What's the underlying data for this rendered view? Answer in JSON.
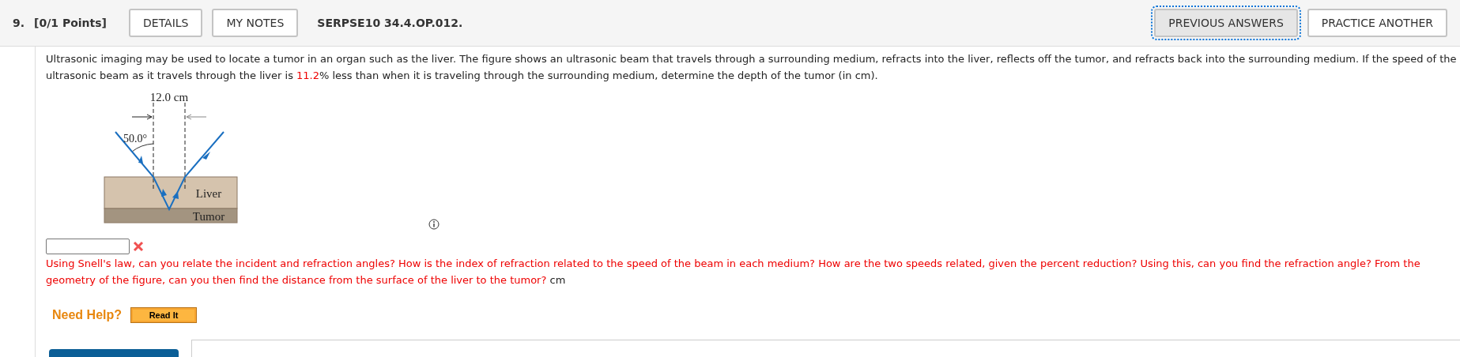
{
  "header": {
    "number": "9.",
    "points": "[0/1 Points]",
    "buttons": [
      {
        "label": "DETAILS",
        "selected": false
      },
      {
        "label": "MY NOTES",
        "selected": false
      }
    ],
    "code": "SERPSE10 34.4.OP.012.",
    "actions": [
      {
        "label": "PREVIOUS ANSWERS",
        "selected": true
      },
      {
        "label": "PRACTICE ANOTHER",
        "selected": false
      }
    ]
  },
  "question": [
    {
      "kind": "normal",
      "text": "Ultrasonic imaging may be used to locate a tumor in an organ such as the liver. The figure shows an ultrasonic beam that travels through a surrounding medium, refracts into the liver, reflects off the tumor, and refracts back into the surrounding medium. If the speed of the ultrasonic beam as it travels through the liver is "
    },
    {
      "kind": "highlight",
      "text": "11.2"
    },
    {
      "kind": "normal",
      "text": "% less than when it is traveling through the surrounding medium, determine the depth of the tumor (in cm)."
    }
  ],
  "figure": {
    "width_label": "12.0 cm",
    "angle_label": "50.0°",
    "layer_labels": [
      "Liver",
      "Tumor"
    ]
  },
  "answer": {
    "correct": false,
    "feedback": "Using Snell's law, can you relate the incident and refraction angles? How is the index of refraction related to the speed of the beam in each medium? How are the two speeds related, given the percent reduction? Using this, can you find the refraction angle? From the geometry of the figure, can you then find the distance from the surface of the liver to the tumor?",
    "unit": "cm"
  },
  "help": {
    "label": "Need Help?",
    "buttons": [
      "Read It"
    ]
  }
}
